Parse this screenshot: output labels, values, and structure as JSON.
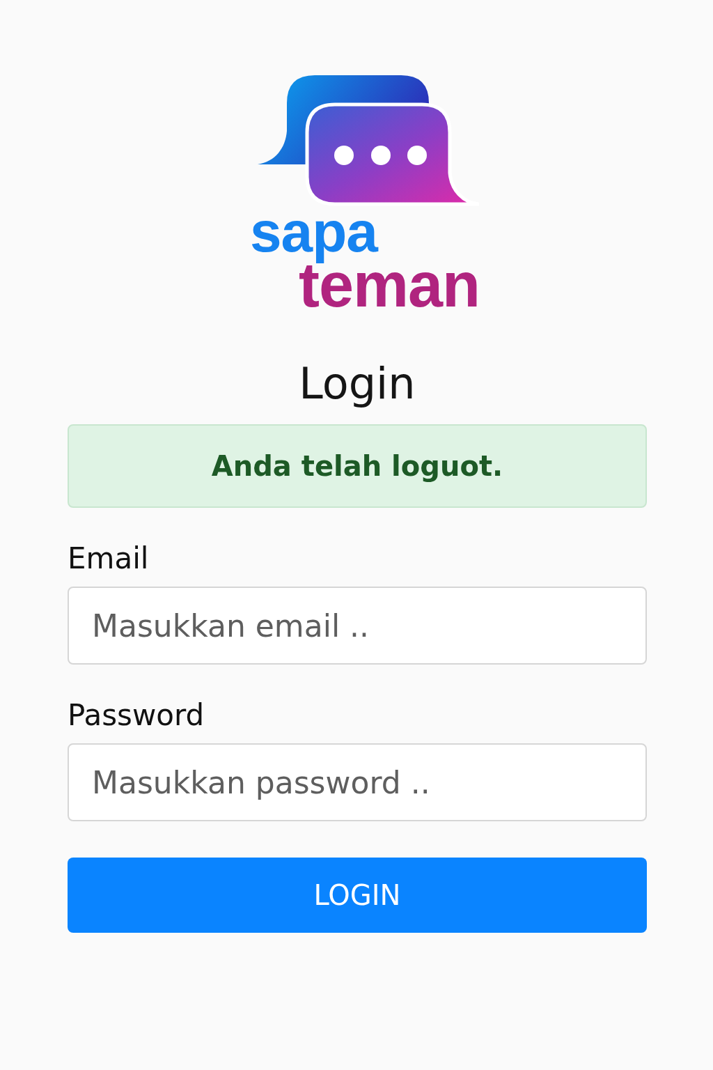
{
  "logo": {
    "line_1": "sapa",
    "line_2": "teman"
  },
  "title": "Login",
  "alert": {
    "text": "Anda telah loguot."
  },
  "fields": [
    {
      "label": "Email",
      "placeholder": "Masukkan email .."
    },
    {
      "label": "Password",
      "placeholder": "Masukkan password .."
    }
  ],
  "submit": "LOGIN"
}
